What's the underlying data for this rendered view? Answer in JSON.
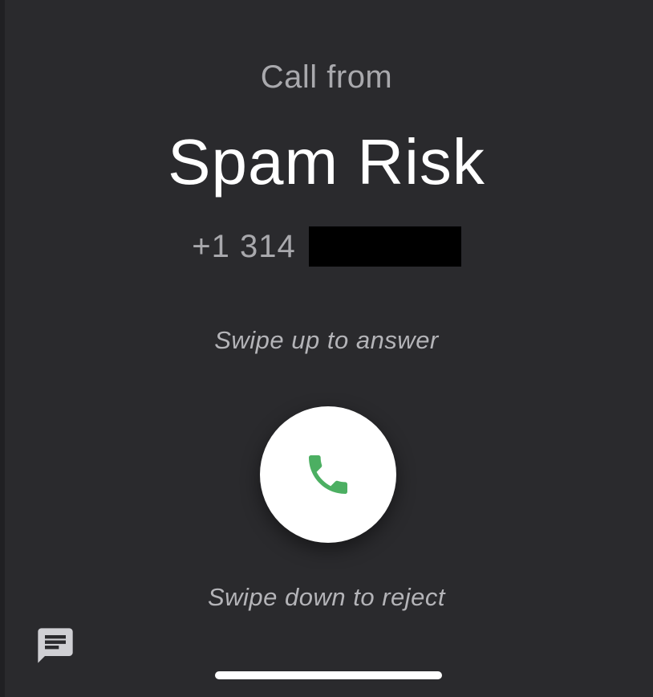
{
  "call": {
    "header": "Call from",
    "caller_name": "Spam Risk",
    "number_prefix": "+1 314"
  },
  "hints": {
    "answer": "Swipe up to answer",
    "reject": "Swipe down to reject"
  },
  "icons": {
    "answer": "phone-icon",
    "message": "message-icon"
  },
  "colors": {
    "background": "#2a2a2d",
    "answer_icon": "#4caf62",
    "answer_button": "#ffffff"
  }
}
